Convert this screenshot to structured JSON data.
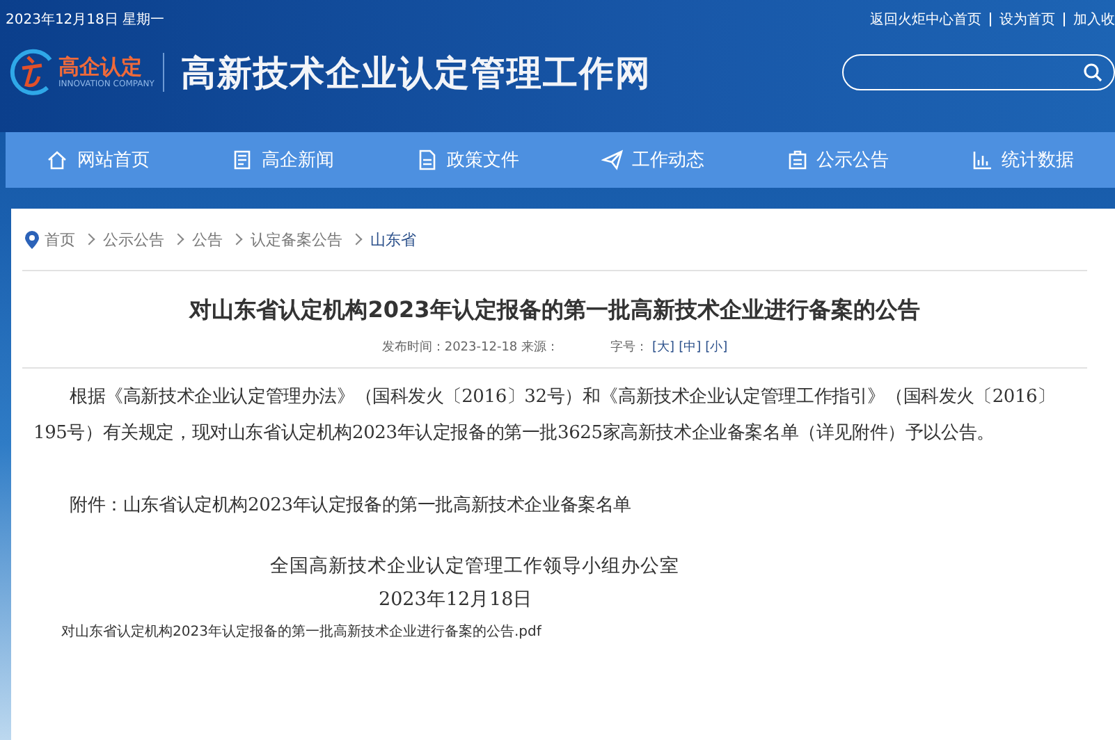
{
  "top_bar": {
    "date": "2023年12月18日 星期一",
    "links": [
      {
        "label": "返回火炬中心首页"
      },
      {
        "label": "设为首页"
      },
      {
        "label": "加入收"
      }
    ]
  },
  "header": {
    "logo_text": "高企认定",
    "logo_subtext": "INNOVATION COMPANY",
    "site_title": "高新技术企业认定管理工作网"
  },
  "nav": [
    {
      "label": "网站首页",
      "kind": "home",
      "selected": false
    },
    {
      "label": "高企新闻",
      "kind": "news",
      "selected": false
    },
    {
      "label": "政策文件",
      "kind": "doc",
      "selected": false
    },
    {
      "label": "工作动态",
      "kind": "plane",
      "selected": false
    },
    {
      "label": "公示公告",
      "kind": "board",
      "selected": false
    },
    {
      "label": "统计数据",
      "kind": "chart",
      "selected": false
    }
  ],
  "breadcrumb": [
    "首页",
    "公示公告",
    "公告",
    "认定备案公告",
    "山东省"
  ],
  "article": {
    "title": "对山东省认定机构2023年认定报备的第一批高新技术企业进行备案的公告",
    "meta": {
      "published": "发布时间：2023-12-18 来源：",
      "font_size_label": "字号：",
      "sizes": [
        "[大]",
        "[中]",
        "[小]"
      ]
    },
    "body": "根据《高新技术企业认定管理办法》（国科发火〔2016〕32号）和《高新技术企业认定管理工作指引》（国科发火〔2016〕195号）有关规定，现对山东省认定机构2023年认定报备的第一批3625家高新技术企业备案名单（详见附件）予以公告。",
    "attachment_note": "附件：山东省认定机构2023年认定报备的第一批高新技术企业备案名单",
    "signature": "全国高新技术企业认定管理工作领导小组办公室",
    "date": "2023年12月18日",
    "attachment_link": "对山东省认定机构2023年认定报备的第一批高新技术企业进行备案的公告.pdf"
  }
}
